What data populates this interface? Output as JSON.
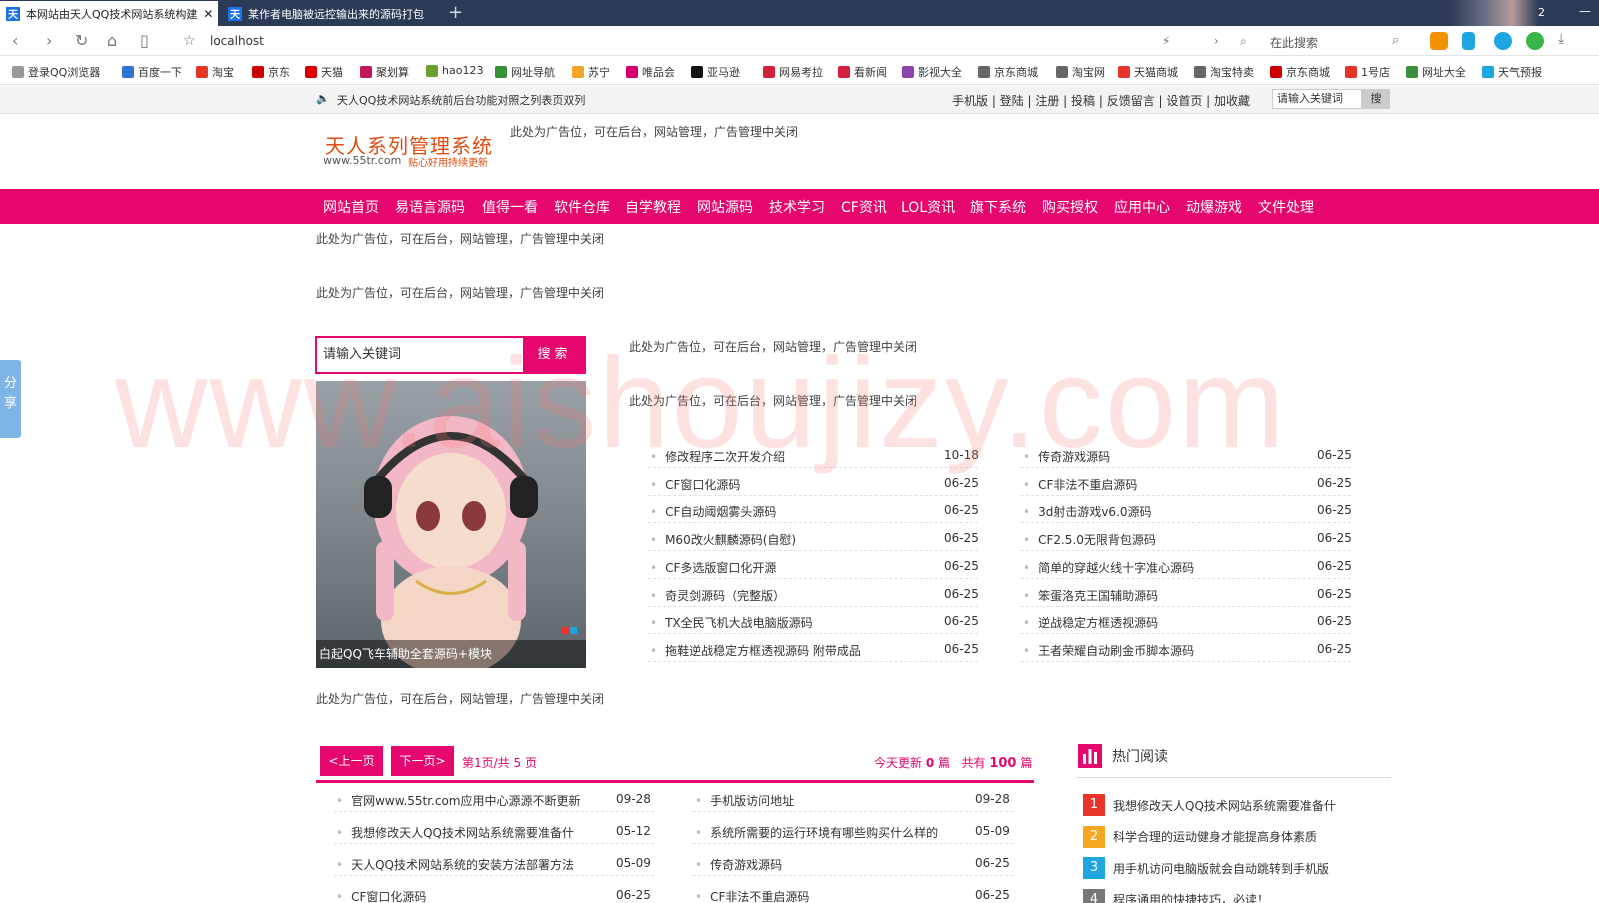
{
  "browser": {
    "tabs": [
      {
        "label": "本网站由天人QQ技术网站系统构建"
      },
      {
        "label": "某作者电脑被远控输出来的源码打包"
      }
    ],
    "tab_count": "2",
    "new_tab": "+",
    "url": "localhost",
    "search_placeholder": "在此搜索",
    "bookmarks": [
      "登录QQ浏览器",
      "百度一下",
      "淘宝",
      "京东",
      "天猫",
      "聚划算",
      "hao123",
      "网址导航",
      "苏宁",
      "唯品会",
      "亚马逊",
      "网易考拉",
      "看新闻",
      "影视大全",
      "京东商城",
      "淘宝网",
      "天猫商城",
      "淘宝特卖",
      "京东商城",
      "1号店",
      "网址大全",
      "天气预报"
    ]
  },
  "topbar": {
    "notice": "天人QQ技术网站系统前后台功能对照之列表页双列",
    "links": "手机版 | 登陆 | 注册 | 投稿 | 反馈留言 | 设首页 | 加收藏",
    "search_value": "请输入关键词",
    "search_btn": "搜"
  },
  "logo": {
    "title": "天人系列管理系统",
    "url": "www.55tr.com",
    "slogan": "贴心好用持续更新"
  },
  "ad_text": "此处为广告位，可在后台，网站管理，广告管理中关闭",
  "nav": [
    "网站首页",
    "易语言源码",
    "值得一看",
    "软件仓库",
    "自学教程",
    "网站源码",
    "技术学习",
    "CF资讯",
    "LOL资讯",
    "旗下系统",
    "购买授权",
    "应用中心",
    "动爆游戏",
    "文件处理"
  ],
  "share": "分享",
  "search": {
    "value": "请输入关键词",
    "button": "搜索"
  },
  "slide": {
    "caption": "白起QQ飞车辅助全套源码+模块"
  },
  "list_left": [
    {
      "title": "修改程序二次开发介绍",
      "date": "10-18"
    },
    {
      "title": "CF窗口化源码",
      "date": "06-25"
    },
    {
      "title": "CF自动阈烟雾头源码",
      "date": "06-25"
    },
    {
      "title": "M60改火麒麟源码(自慰)",
      "date": "06-25"
    },
    {
      "title": "CF多选版窗口化开源",
      "date": "06-25"
    },
    {
      "title": "奇灵剑源码（完整版）",
      "date": "06-25"
    },
    {
      "title": "TX全民飞机大战电脑版源码",
      "date": "06-25"
    },
    {
      "title": "拖鞋逆战稳定方框透视源码 附带成品",
      "date": "06-25"
    }
  ],
  "list_right": [
    {
      "title": "传奇游戏源码",
      "date": "06-25"
    },
    {
      "title": "CF非法不重启源码",
      "date": "06-25"
    },
    {
      "title": "3d射击游戏v6.0源码",
      "date": "06-25"
    },
    {
      "title": "CF2.5.0无限背包源码",
      "date": "06-25"
    },
    {
      "title": "简单的穿越火线十字准心源码",
      "date": "06-25"
    },
    {
      "title": "笨蛋洛克王国辅助源码",
      "date": "06-25"
    },
    {
      "title": "逆战稳定方框透视源码",
      "date": "06-25"
    },
    {
      "title": "王者荣耀自动刷金币脚本源码",
      "date": "06-25"
    }
  ],
  "pager": {
    "prev": "<上一页",
    "next": "下一页>",
    "page_info": "第1页/共 5 页",
    "today_label": "今天更新",
    "today_count": "0",
    "today_unit": "篇",
    "total_label": "共有",
    "total_count": "100",
    "total_unit": "篇"
  },
  "bottom_left": [
    {
      "title": "官网www.55tr.com应用中心源源不断更新",
      "date": "09-28"
    },
    {
      "title": "我想修改天人QQ技术网站系统需要准备什",
      "date": "05-12"
    },
    {
      "title": "天人QQ技术网站系统的安装方法部署方法",
      "date": "05-09"
    },
    {
      "title": "CF窗口化源码",
      "date": "06-25"
    }
  ],
  "bottom_right": [
    {
      "title": "手机版访问地址",
      "date": "09-28"
    },
    {
      "title": "系统所需要的运行环境有哪些购买什么样的",
      "date": "05-09"
    },
    {
      "title": "传奇游戏源码",
      "date": "06-25"
    },
    {
      "title": "CF非法不重启源码",
      "date": "06-25"
    }
  ],
  "hot": {
    "title": "热门阅读",
    "items": [
      {
        "num": "1",
        "title": "我想修改天人QQ技术网站系统需要准备什",
        "color": "#e8352b"
      },
      {
        "num": "2",
        "title": "科学合理的运动健身才能提高身体素质",
        "color": "#f5a623"
      },
      {
        "num": "3",
        "title": "用手机访问电脑版就会自动跳转到手机版",
        "color": "#1ea6e0"
      },
      {
        "num": "4",
        "title": "程序通用的快捷技巧，必读！",
        "color": "#777777"
      }
    ]
  },
  "watermark": "www.aishoujizy.com",
  "colors": {
    "brand": "#e5066e",
    "logo": "#e04b12"
  }
}
